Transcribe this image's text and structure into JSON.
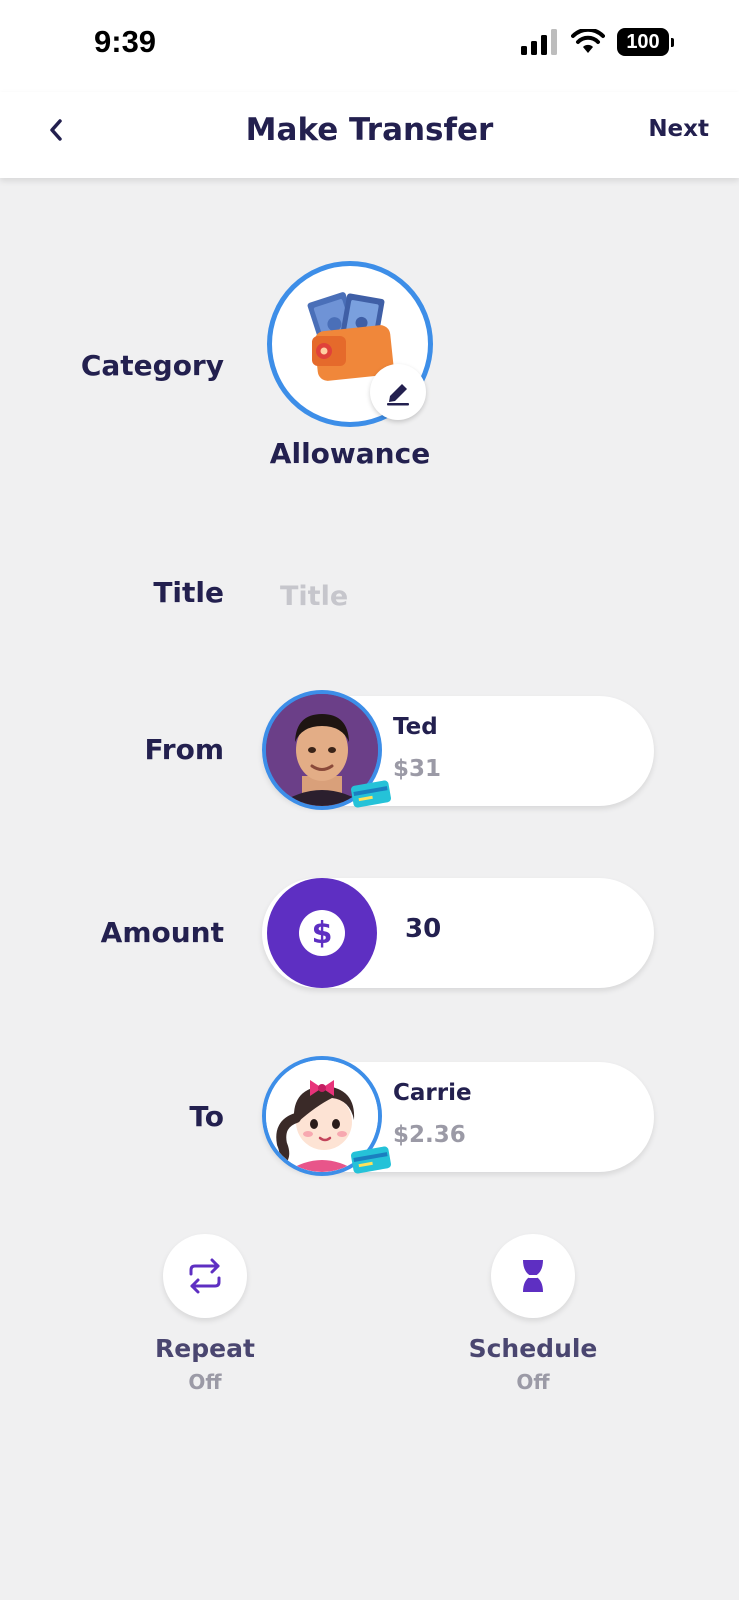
{
  "status_bar": {
    "time": "9:39",
    "battery": "100"
  },
  "nav": {
    "title": "Make Transfer",
    "next_label": "Next"
  },
  "category": {
    "label": "Category",
    "name": "Allowance",
    "icon": "wallet-icon"
  },
  "title_field": {
    "label": "Title",
    "placeholder": "Title",
    "value": ""
  },
  "from": {
    "label": "From",
    "name": "Ted",
    "balance": "$31"
  },
  "amount": {
    "label": "Amount",
    "symbol": "$",
    "value": "30"
  },
  "to": {
    "label": "To",
    "name": "Carrie",
    "balance": "$2.36"
  },
  "options": [
    {
      "label": "Repeat",
      "state": "Off",
      "icon": "repeat-icon"
    },
    {
      "label": "Schedule",
      "state": "Off",
      "icon": "hourglass-icon"
    }
  ],
  "colors": {
    "accent": "#5e2fc2",
    "ring": "#3d8ee8",
    "text": "#23204f",
    "muted": "#9b9aa6"
  }
}
